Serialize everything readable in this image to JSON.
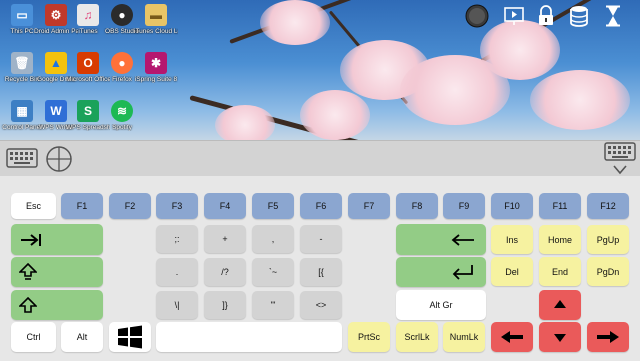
{
  "desktop": {
    "icons": [
      {
        "label": "This PC",
        "icon": "computer-icon",
        "color": "#4a90d9"
      },
      {
        "label": "Droid Admin Passwords",
        "icon": "gear-icon",
        "color": "#c0392b"
      },
      {
        "label": "iTunes",
        "icon": "music-icon",
        "color": "#e9e9e9"
      },
      {
        "label": "OBS Studio",
        "icon": "record-icon",
        "color": "#2b2b2b"
      },
      {
        "label": "iTunes Cloud Logs",
        "icon": "folder-icon",
        "color": "#e8c567"
      },
      {
        "label": "Recycle Bin",
        "icon": "trash-icon",
        "color": "#9fb3c8"
      },
      {
        "label": "Google Drive",
        "icon": "drive-icon",
        "color": "#f4c20d"
      },
      {
        "label": "Microsoft Office Apps",
        "icon": "office-icon",
        "color": "#d83b01"
      },
      {
        "label": "Firefox",
        "icon": "firefox-icon",
        "color": "#ff7139"
      },
      {
        "label": "iSpring Suite 8",
        "icon": "ispring-icon",
        "color": "#b5176f"
      },
      {
        "label": "Control Panel",
        "icon": "control-panel-icon",
        "color": "#3d7fc4"
      },
      {
        "label": "WPS Writer",
        "icon": "wps-writer-icon",
        "color": "#2f6fd6"
      },
      {
        "label": "WPS Spreadsheets",
        "icon": "wps-sheets-icon",
        "color": "#1aa25a"
      },
      {
        "label": "Spotify",
        "icon": "spotify-icon",
        "color": "#1db954"
      }
    ]
  },
  "toolbar": {
    "items": [
      {
        "name": "mouse-icon"
      },
      {
        "name": "presentation-icon"
      },
      {
        "name": "lock-icon"
      },
      {
        "name": "database-icon"
      },
      {
        "name": "hourglass-icon"
      }
    ]
  },
  "midbar": {
    "left": [
      "keyboard-icon",
      "crosshair-icon"
    ],
    "right": [
      "keyboard-icon",
      "chevron-down-icon"
    ]
  },
  "keys": {
    "esc": "Esc",
    "f": [
      "F1",
      "F2",
      "F3",
      "F4",
      "F5",
      "F6",
      "F7",
      "F8",
      "F9",
      "F10",
      "F11",
      "F12"
    ],
    "sym": [
      ";:",
      "+",
      ",",
      "-",
      ".",
      "/?",
      "`~",
      "[{",
      "\\|",
      "]}",
      "'\"",
      "<>"
    ],
    "ins": "Ins",
    "home": "Home",
    "pgup": "PgUp",
    "del": "Del",
    "end": "End",
    "pgdn": "PgDn",
    "altgr": "Alt Gr",
    "ctrl": "Ctrl",
    "alt": "Alt",
    "prtsc": "PrtSc",
    "scrllk": "ScrlLk",
    "numlk": "NumLk"
  },
  "colors": {
    "key_white": "#ffffff",
    "key_blue": "#8ba6d0",
    "key_green": "#93cc86",
    "key_gray": "#d3d3d3",
    "key_yellow": "#f6f2a0",
    "key_red": "#ea5a5a"
  }
}
